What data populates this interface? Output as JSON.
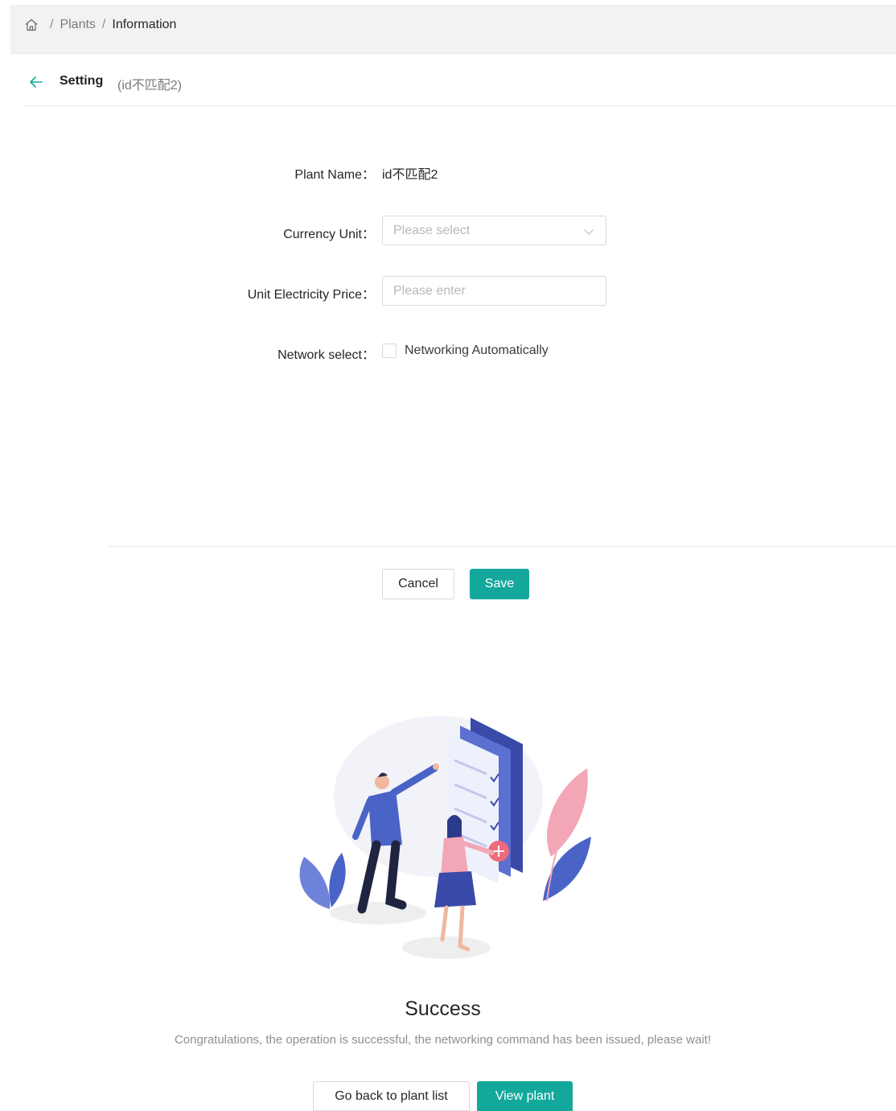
{
  "breadcrumb": {
    "items": [
      "Plants",
      "Information"
    ],
    "separator": "/"
  },
  "header": {
    "title": "Setting",
    "subtitle": "(id不匹配2)"
  },
  "form": {
    "plant_name": {
      "label": "Plant Name：",
      "value": "id不匹配2"
    },
    "currency_unit": {
      "label": "Currency Unit：",
      "placeholder": "Please select"
    },
    "unit_price": {
      "label": "Unit Electricity Price：",
      "placeholder": "Please enter"
    },
    "network": {
      "label": "Network select：",
      "option": "Networking Automatically"
    }
  },
  "actions": {
    "cancel": "Cancel",
    "save": "Save"
  },
  "result": {
    "title": "Success",
    "description": "Congratulations, the operation is successful, the networking command has been issued, please wait!",
    "back_button": "Go back to plant list",
    "view_button": "View plant"
  },
  "colors": {
    "accent": "#14a89c",
    "topbar_bg": "#f0f2f4",
    "illustration_blue": "#4a63c7",
    "illustration_pink": "#f3a6b5"
  },
  "icons": {
    "home": "home-icon",
    "back": "arrow-left-icon",
    "select": "chevron-down-icon"
  }
}
